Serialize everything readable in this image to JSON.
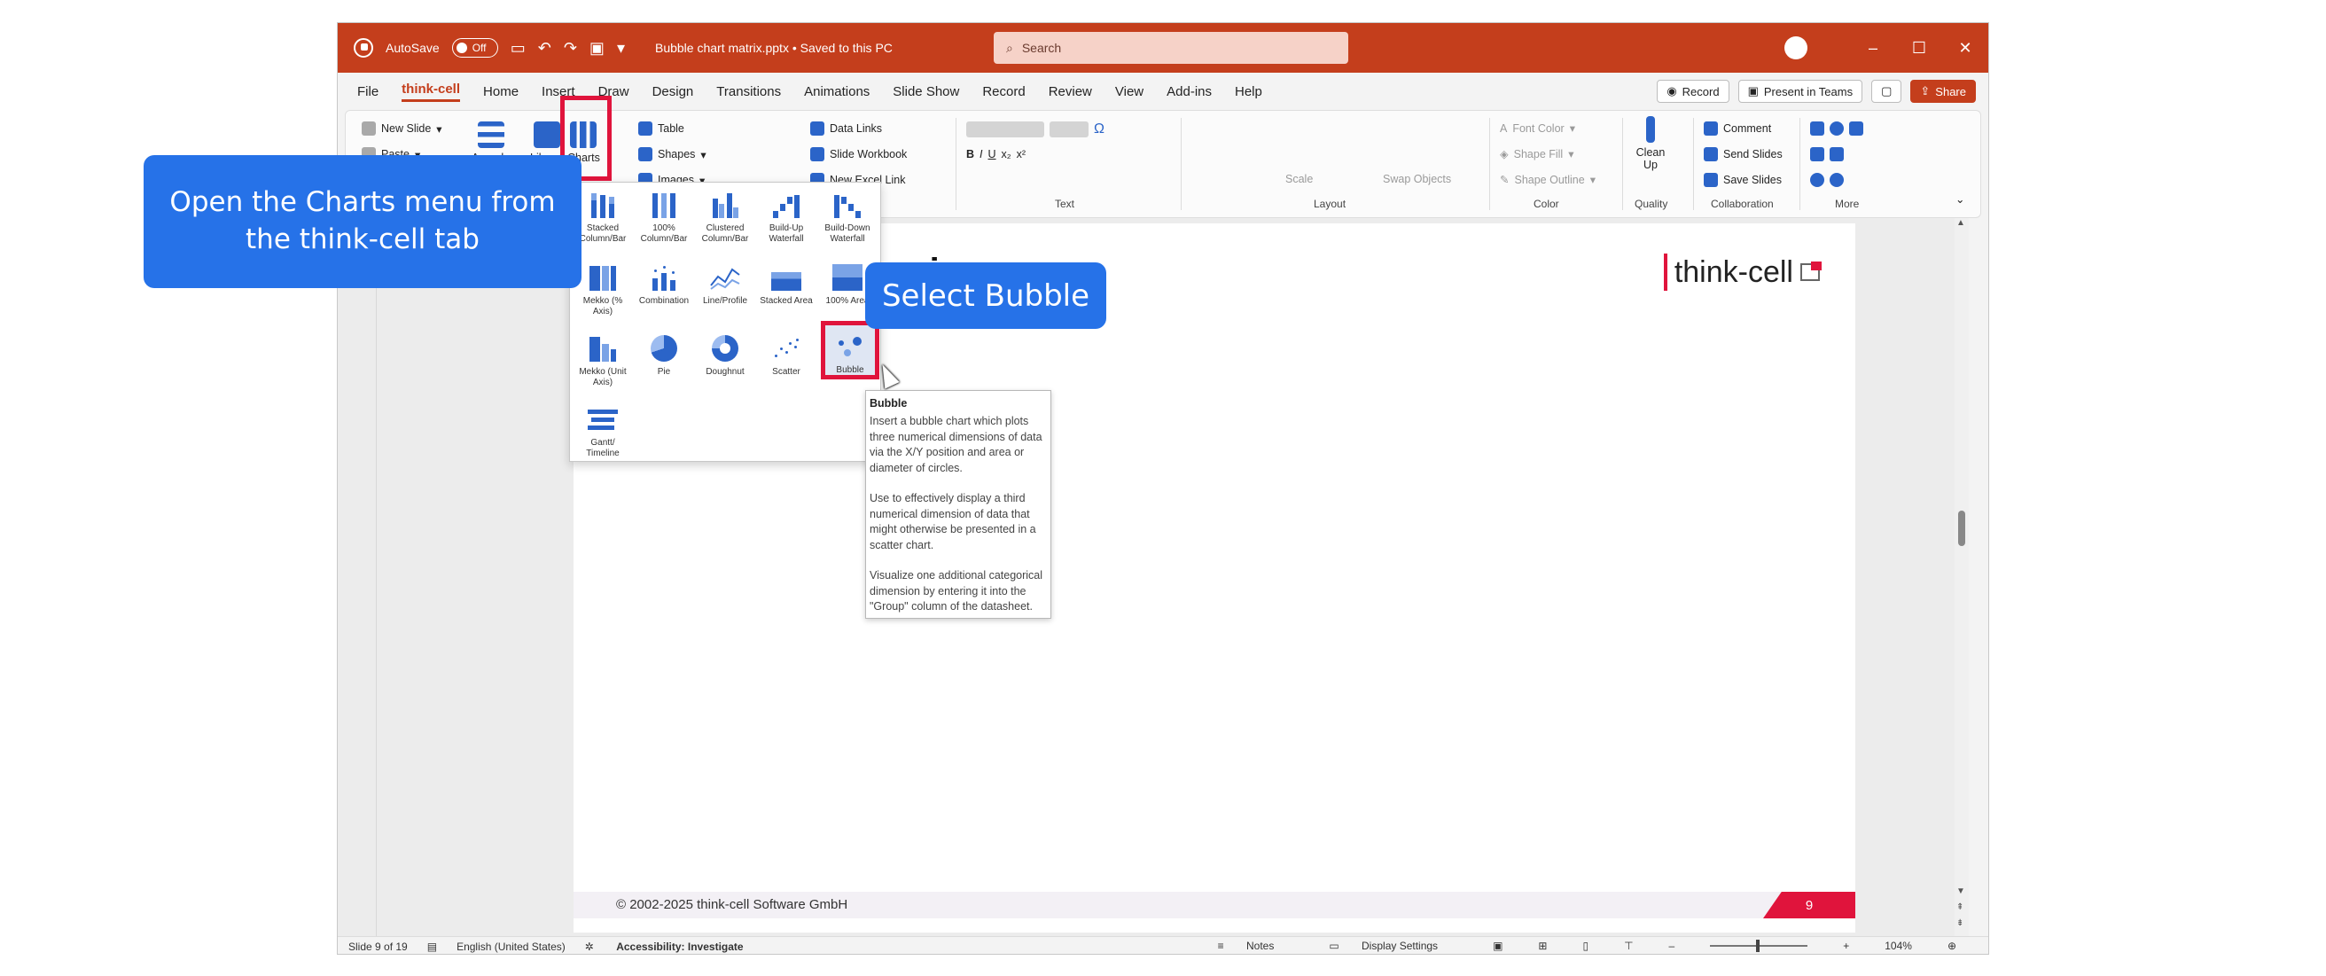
{
  "titlebar": {
    "autosave_label": "AutoSave",
    "autosave_state": "Off",
    "doc_title": "Bubble chart matrix.pptx • Saved to this PC",
    "search_placeholder": "Search",
    "accent": "#c43e1c"
  },
  "tabs": [
    "File",
    "think-cell",
    "Home",
    "Insert",
    "Draw",
    "Design",
    "Transitions",
    "Animations",
    "Slide Show",
    "Record",
    "Review",
    "View",
    "Add-ins",
    "Help"
  ],
  "tab_actions": {
    "record": "Record",
    "present": "Present in Teams",
    "share": "Share"
  },
  "ribbon": {
    "new_slide": "New Slide",
    "paste": "Paste",
    "agenda": "Agenda",
    "library": "Library",
    "charts": "Charts",
    "table": "Table",
    "shapes": "Shapes",
    "images": "Images",
    "data_links": "Data Links",
    "slide_workbook": "Slide Workbook",
    "new_excel_link": "New Excel Link",
    "text_group": "Text",
    "layout_group": "Layout",
    "scale": "Scale",
    "swap_objects": "Swap Objects",
    "font_color": "Font Color",
    "shape_fill": "Shape Fill",
    "shape_outline": "Shape Outline",
    "color_group": "Color",
    "clean_up": "Clean Up",
    "quality_group": "Quality",
    "comment": "Comment",
    "send_slides": "Send Slides",
    "save_slides": "Save Slides",
    "collaboration_group": "Collaboration",
    "more_group": "More"
  },
  "charts_menu": [
    {
      "label": "Stacked Column/Bar"
    },
    {
      "label": "100% Column/Bar"
    },
    {
      "label": "Clustered Column/Bar"
    },
    {
      "label": "Build-Up Waterfall"
    },
    {
      "label": "Build-Down Waterfall"
    },
    {
      "label": "Mekko (% Axis)"
    },
    {
      "label": "Combination"
    },
    {
      "label": "Line/Profile"
    },
    {
      "label": "Stacked Area"
    },
    {
      "label": "100% Area"
    },
    {
      "label": "Mekko (Unit Axis)"
    },
    {
      "label": "Pie"
    },
    {
      "label": "Doughnut"
    },
    {
      "label": "Scatter"
    },
    {
      "label": "Bubble"
    },
    {
      "label": "Gantt/ Timeline"
    }
  ],
  "tooltip": {
    "title": "Bubble",
    "p1": "Insert a bubble chart which plots three numerical dimensions of data via the X/Y position and area or diameter of circles.",
    "p2": "Use to effectively display a third numerical dimension of data that might otherwise be presented in a scatter chart.",
    "p3": "Visualize one additional categorical dimension by entering it into the \"Group\" column of the datasheet."
  },
  "slide": {
    "title_fragment": "rix",
    "brand": "think-cell",
    "copyright": "© 2002-2025 think-cell Software GmbH",
    "page_number": "9"
  },
  "statusbar": {
    "slide_info": "Slide 9 of 19",
    "language": "English (United States)",
    "accessibility": "Accessibility: Investigate",
    "notes": "Notes",
    "display_settings": "Display Settings",
    "zoom": "104%"
  },
  "callouts": {
    "step1": "Open the Charts menu from the think-cell tab",
    "step2": "Select Bubble"
  }
}
